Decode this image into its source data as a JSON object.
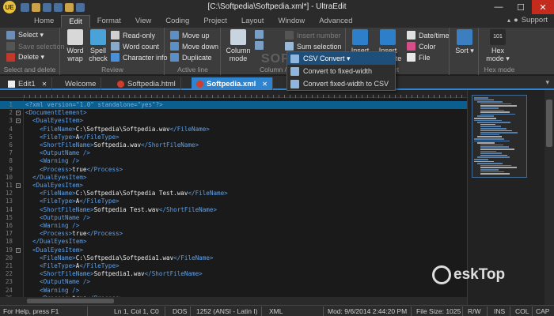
{
  "window": {
    "title": "[C:\\Softpedia\\Softpedia.xml*] - UltraEdit",
    "logo_text": "UE",
    "min": "—",
    "max": "☐",
    "close": "✕"
  },
  "ribbon": {
    "tabs": [
      "Home",
      "Edit",
      "Format",
      "View",
      "Coding",
      "Project",
      "Layout",
      "Window",
      "Advanced"
    ],
    "active_tab": "Edit",
    "support_label": "Support",
    "groups": {
      "select": {
        "label": "Select and delete",
        "select": "Select ▾",
        "save_selection": "Save selection",
        "delete": "Delete ▾"
      },
      "review": {
        "label": "Review",
        "word_wrap": "Word wrap",
        "spell_check": "Spell check",
        "read_only": "Read-only",
        "word_count": "Word count",
        "character_info": "Character info"
      },
      "active_line": {
        "label": "Active line",
        "move_up": "Move up",
        "move_down": "Move down",
        "duplicate": "Duplicate"
      },
      "column": {
        "label": "Column /",
        "column_mode": "Column mode",
        "insert_number": "Insert number",
        "sum_selection": "Sum selection",
        "csv_convert": "CSV Convert ▾"
      },
      "insert": {
        "label": "sert",
        "insert_item": "Insert item ▾",
        "insert_template": "Insert template ▾",
        "date_time": "Date/time",
        "color": "Color",
        "file": "File"
      },
      "sort": {
        "label": "",
        "sort": "Sort ▾"
      },
      "hex": {
        "label": "Hex mode",
        "hex_mode": "Hex mode ▾",
        "hex_icon": "101"
      }
    },
    "csv_menu": {
      "items": [
        "CSV Convert ▾",
        "Convert to fixed-width",
        "Convert fixed-width to CSV"
      ],
      "watermark": "SOFTPEDIA"
    }
  },
  "doc_tabs": [
    {
      "label": "Edit1",
      "icon": "doc-icon-white",
      "active": false
    },
    {
      "label": "Welcome",
      "icon": "doc-icon-red",
      "active": false
    },
    {
      "label": "Softpedia.html",
      "icon": "doc-icon-red",
      "active": false
    },
    {
      "label": "Softpedia.xml",
      "icon": "doc-icon-red",
      "active": true
    }
  ],
  "tab_close_glyph": "✕",
  "editor": {
    "lines": [
      {
        "n": "1",
        "fold": "",
        "indent": 0,
        "parts": [
          [
            "pi",
            "<?xml version=\"1.0\" standalone=\"yes\"?>"
          ]
        ],
        "highlight": true
      },
      {
        "n": "2",
        "fold": "-",
        "indent": 0,
        "parts": [
          [
            "tag",
            "<DocumentElement>"
          ]
        ]
      },
      {
        "n": "3",
        "fold": "-",
        "indent": 1,
        "parts": [
          [
            "tag",
            "<DualEyesItem>"
          ]
        ]
      },
      {
        "n": "4",
        "fold": "",
        "indent": 2,
        "parts": [
          [
            "tag",
            "<FileName>"
          ],
          [
            "txt",
            "C:\\Softpedia\\Softpedia.wav"
          ],
          [
            "tag",
            "</FileName>"
          ]
        ]
      },
      {
        "n": "5",
        "fold": "",
        "indent": 2,
        "parts": [
          [
            "tag",
            "<FileType>"
          ],
          [
            "txt",
            "A"
          ],
          [
            "tag",
            "</FileType>"
          ]
        ]
      },
      {
        "n": "6",
        "fold": "",
        "indent": 2,
        "parts": [
          [
            "tag",
            "<ShortFileName>"
          ],
          [
            "txt",
            "Softpedia.wav"
          ],
          [
            "tag",
            "</ShortFileName>"
          ]
        ]
      },
      {
        "n": "7",
        "fold": "",
        "indent": 2,
        "parts": [
          [
            "tag",
            "<OutputName />"
          ]
        ]
      },
      {
        "n": "8",
        "fold": "",
        "indent": 2,
        "parts": [
          [
            "tag",
            "<Warning />"
          ]
        ]
      },
      {
        "n": "9",
        "fold": "",
        "indent": 2,
        "parts": [
          [
            "tag",
            "<Process>"
          ],
          [
            "txt",
            "true"
          ],
          [
            "tag",
            "</Process>"
          ]
        ]
      },
      {
        "n": "10",
        "fold": "",
        "indent": 1,
        "parts": [
          [
            "tag",
            "</DualEyesItem>"
          ]
        ]
      },
      {
        "n": "11",
        "fold": "-",
        "indent": 1,
        "parts": [
          [
            "tag",
            "<DualEyesItem>"
          ]
        ]
      },
      {
        "n": "12",
        "fold": "",
        "indent": 2,
        "parts": [
          [
            "tag",
            "<FileName>"
          ],
          [
            "txt",
            "C:\\Softpedia\\Softpedia Test.wav"
          ],
          [
            "tag",
            "</FileName>"
          ]
        ]
      },
      {
        "n": "13",
        "fold": "",
        "indent": 2,
        "parts": [
          [
            "tag",
            "<FileType>"
          ],
          [
            "txt",
            "A"
          ],
          [
            "tag",
            "</FileType>"
          ]
        ]
      },
      {
        "n": "14",
        "fold": "",
        "indent": 2,
        "parts": [
          [
            "tag",
            "<ShortFileName>"
          ],
          [
            "txt",
            "Softpedia Test.wav"
          ],
          [
            "tag",
            "</ShortFileName>"
          ]
        ]
      },
      {
        "n": "15",
        "fold": "",
        "indent": 2,
        "parts": [
          [
            "tag",
            "<OutputName />"
          ]
        ]
      },
      {
        "n": "16",
        "fold": "",
        "indent": 2,
        "parts": [
          [
            "tag",
            "<Warning />"
          ]
        ]
      },
      {
        "n": "17",
        "fold": "",
        "indent": 2,
        "parts": [
          [
            "tag",
            "<Process>"
          ],
          [
            "txt",
            "true"
          ],
          [
            "tag",
            "</Process>"
          ]
        ]
      },
      {
        "n": "18",
        "fold": "",
        "indent": 1,
        "parts": [
          [
            "tag",
            "</DualEyesItem>"
          ]
        ]
      },
      {
        "n": "19",
        "fold": "-",
        "indent": 1,
        "parts": [
          [
            "tag",
            "<DualEyesItem>"
          ]
        ]
      },
      {
        "n": "20",
        "fold": "",
        "indent": 2,
        "parts": [
          [
            "tag",
            "<FileName>"
          ],
          [
            "txt",
            "C:\\Softpedia\\Softpedia1.wav"
          ],
          [
            "tag",
            "</FileName>"
          ]
        ]
      },
      {
        "n": "21",
        "fold": "",
        "indent": 2,
        "parts": [
          [
            "tag",
            "<FileType>"
          ],
          [
            "txt",
            "A"
          ],
          [
            "tag",
            "</FileType>"
          ]
        ]
      },
      {
        "n": "22",
        "fold": "",
        "indent": 2,
        "parts": [
          [
            "tag",
            "<ShortFileName>"
          ],
          [
            "txt",
            "Softpedia1.wav"
          ],
          [
            "tag",
            "</ShortFileName>"
          ]
        ]
      },
      {
        "n": "23",
        "fold": "",
        "indent": 2,
        "parts": [
          [
            "tag",
            "<OutputName />"
          ]
        ]
      },
      {
        "n": "24",
        "fold": "",
        "indent": 2,
        "parts": [
          [
            "tag",
            "<Warning />"
          ]
        ]
      },
      {
        "n": "25",
        "fold": "",
        "indent": 2,
        "parts": [
          [
            "tag",
            "<Process>"
          ],
          [
            "txt",
            "true"
          ],
          [
            "tag",
            "</Process>"
          ]
        ]
      }
    ]
  },
  "watermark": {
    "text": "eskTop",
    "icon": "desktop-logo-icon"
  },
  "status": {
    "help": "For Help, press F1",
    "position": "Ln 1, Col 1, C0",
    "line_ending": "DOS",
    "encoding": "1252  (ANSI - Latin I)",
    "syntax": "XML",
    "modified": "Mod: 9/6/2014 2:44:20 PM",
    "file_size": "File Size: 1025",
    "rw": "R/W",
    "ins": "INS",
    "col": "COL",
    "cap": "CAP"
  },
  "colors": {
    "accent": "#2f84d0",
    "tag": "#5fa0e8",
    "highlight_line": "#0b5f8f",
    "close_button": "#c42b1c"
  }
}
